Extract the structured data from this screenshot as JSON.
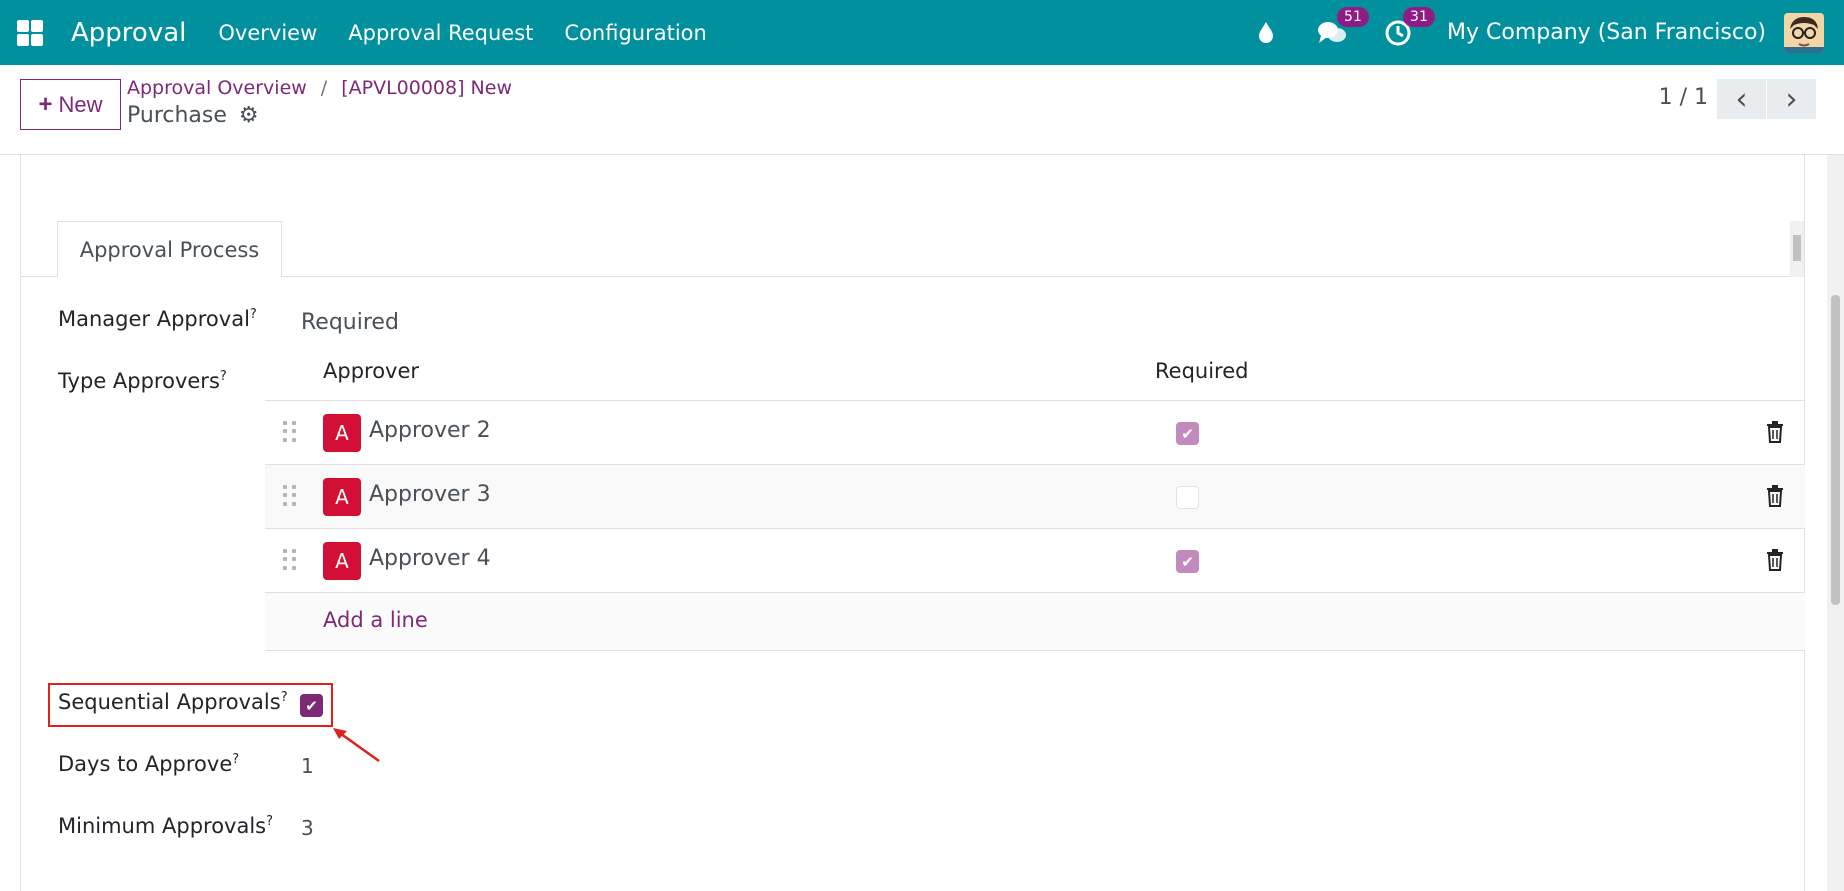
{
  "navbar": {
    "brand": "Approval",
    "menu": [
      "Overview",
      "Approval Request",
      "Configuration"
    ],
    "messages_count": "51",
    "activities_count": "31",
    "company": "My Company (San Francisco)",
    "icons": [
      "apps-grid-icon",
      "droplet-icon",
      "chat-icon",
      "clock-icon"
    ]
  },
  "control_panel": {
    "new_label": "New",
    "breadcrumb": [
      "Approval Overview",
      "[APVL00008] New"
    ],
    "breadcrumb_sep": "/",
    "record_name": "Purchase",
    "pager": "1 / 1"
  },
  "tabs": [
    "Approval Process"
  ],
  "form": {
    "manager_approval_label": "Manager Approval",
    "manager_approval_value": "Required",
    "type_approvers_label": "Type Approvers",
    "help_mark": "?",
    "table": {
      "col_approver": "Approver",
      "col_required": "Required",
      "rows": [
        {
          "initial": "A",
          "name": "Approver 2",
          "required": true
        },
        {
          "initial": "A",
          "name": "Approver 3",
          "required": false
        },
        {
          "initial": "A",
          "name": "Approver 4",
          "required": true
        }
      ],
      "add_line": "Add a line"
    },
    "sequential_label": "Sequential Approvals",
    "sequential_value": true,
    "days_label": "Days to Approve",
    "days_value": "1",
    "min_label": "Minimum Approvals",
    "min_value": "3"
  },
  "colors": {
    "navbar": "#01919e",
    "accent": "#7c2a76",
    "avatar": "#d40f36",
    "highlight": "#e0201a"
  }
}
